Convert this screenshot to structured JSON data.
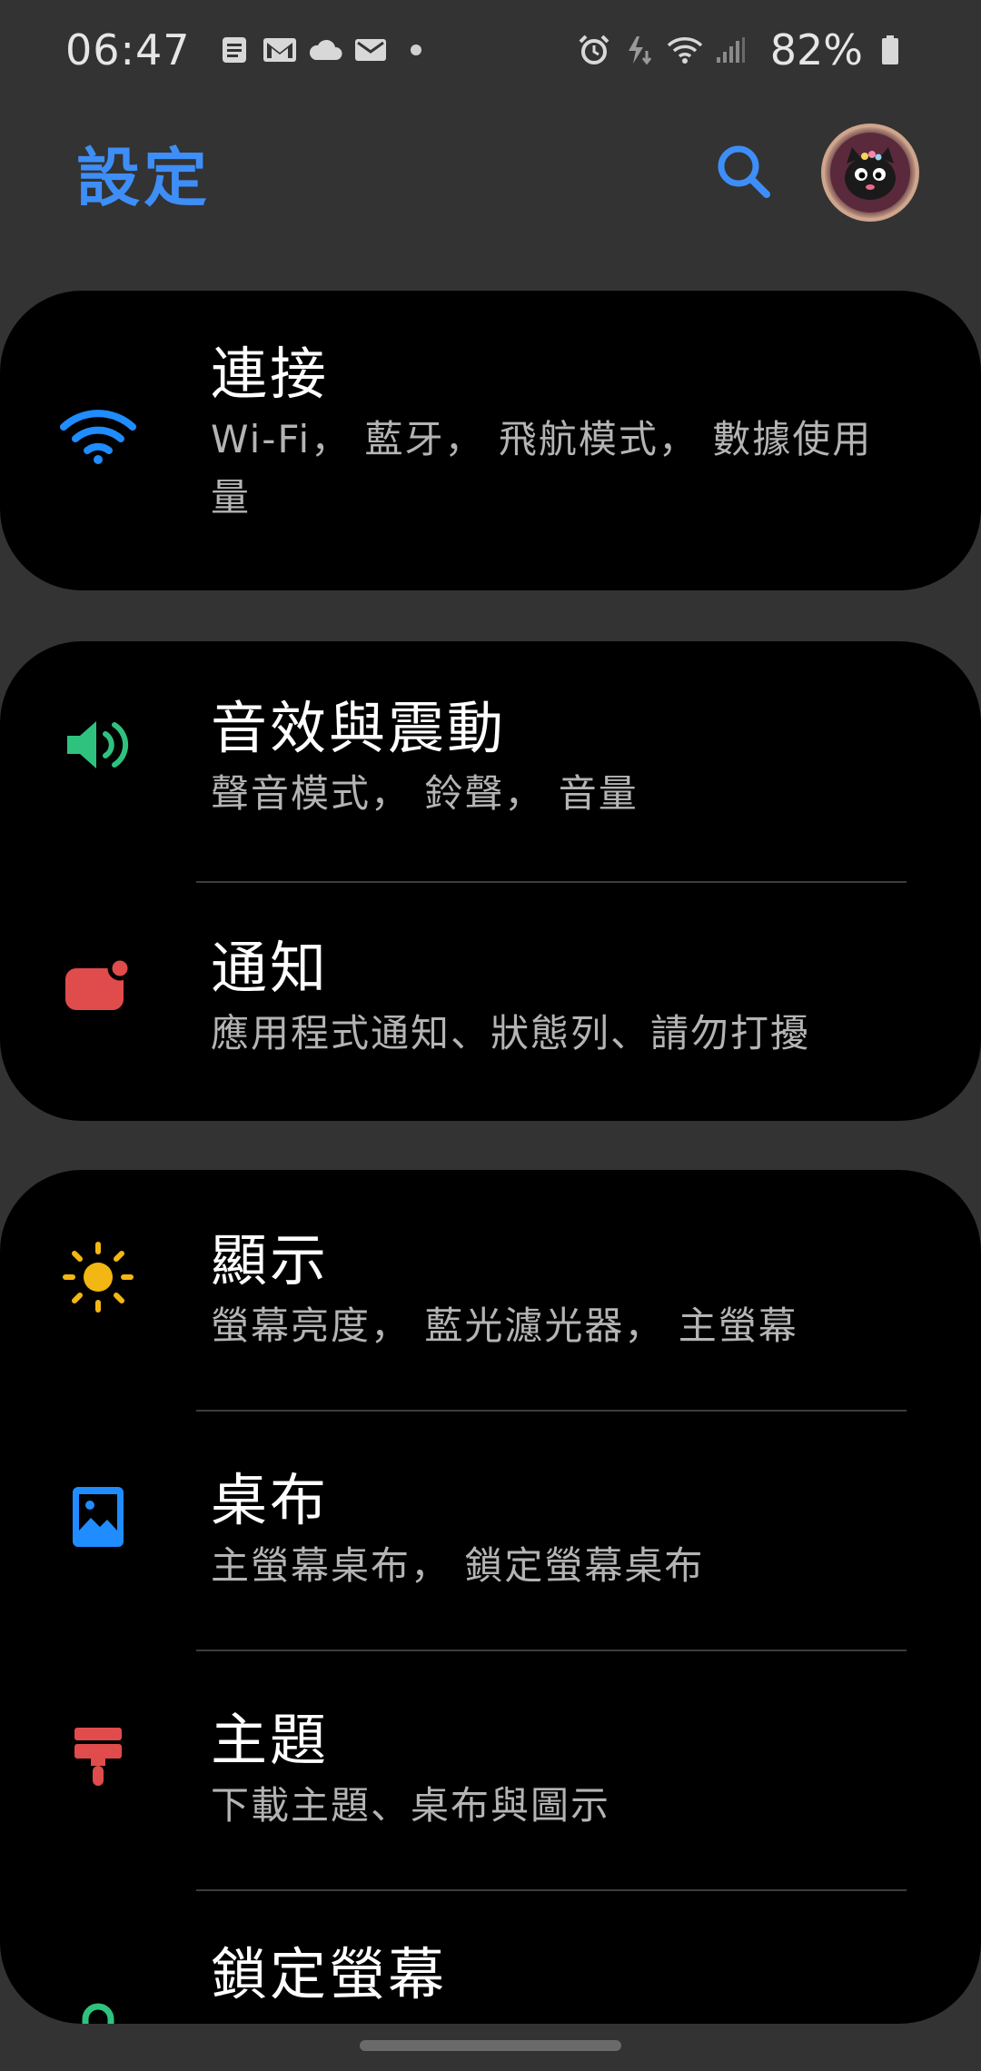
{
  "status_bar": {
    "time": "06:47",
    "battery": "82%",
    "left_icons": [
      "notes-icon",
      "gmail-icon",
      "cloud-icon",
      "mail-icon",
      "dot-icon"
    ],
    "right_icons": [
      "alarm-icon",
      "data-icon",
      "wifi-icon",
      "signal-icon",
      "battery-icon"
    ]
  },
  "header": {
    "title": "設定",
    "search_icon": "search-icon",
    "avatar_icon": "avatar-cat"
  },
  "colors": {
    "background": "#333333",
    "card": "#000000",
    "accent": "#3e8ef7",
    "wifi": "#1f8cff",
    "sound": "#2ec27e",
    "notification": "#e04b4b",
    "display": "#f2b712",
    "wallpaper": "#1f8cff",
    "themes": "#e04b4b",
    "lock": "#2ec27e"
  },
  "settings": {
    "connections": {
      "title": "連接",
      "subtitle": "Wi-Fi， 藍牙， 飛航模式， 數據使用量",
      "icon": "wifi-icon"
    },
    "sounds": {
      "title": "音效與震動",
      "subtitle": "聲音模式， 鈴聲， 音量",
      "icon": "speaker-icon"
    },
    "notifications": {
      "title": "通知",
      "subtitle": "應用程式通知、狀態列、請勿打擾",
      "icon": "notification-icon"
    },
    "display": {
      "title": "顯示",
      "subtitle": "螢幕亮度， 藍光濾光器， 主螢幕",
      "icon": "sun-icon"
    },
    "wallpaper": {
      "title": "桌布",
      "subtitle": "主螢幕桌布， 鎖定螢幕桌布",
      "icon": "image-icon"
    },
    "themes": {
      "title": "主題",
      "subtitle": "下載主題、桌布與圖示",
      "icon": "paintbrush-icon"
    },
    "lock_screen": {
      "title": "鎖定螢幕",
      "icon": "lock-icon"
    }
  }
}
